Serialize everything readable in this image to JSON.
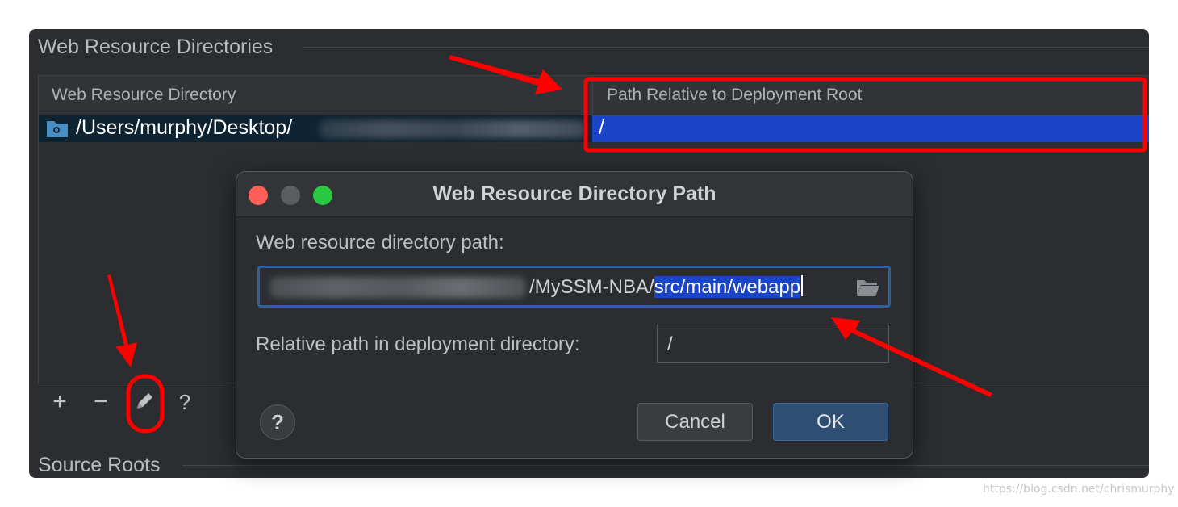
{
  "panel": {
    "section_title": "Web Resource Directories",
    "section2_title": "Source Roots",
    "table": {
      "headers": [
        "Web Resource Directory",
        "Path Relative to Deployment Root"
      ],
      "row": {
        "directory": "/Users/murphy/Desktop/",
        "relative_path": "/"
      }
    },
    "toolbar": {
      "add": "+",
      "remove": "−",
      "help": "?"
    }
  },
  "dialog": {
    "title": "Web Resource Directory Path",
    "path_label": "Web resource directory path:",
    "path_value_visible": "/MySSM-NBA/",
    "path_value_selected": "src/main/webapp",
    "relative_label": "Relative path in deployment directory:",
    "relative_value": "/",
    "help_label": "?",
    "cancel_label": "Cancel",
    "ok_label": "OK"
  },
  "watermark": "https://blog.csdn.net/chrismurphy",
  "colors": {
    "panel_bg": "#2b2d30",
    "selection_blue": "#1b45c8",
    "annotation_red": "#ff0000",
    "traffic_red": "#ff5f57",
    "traffic_gray": "#5c5d60",
    "traffic_green": "#28c840"
  },
  "icons": [
    "folder-icon",
    "browse-folder-icon",
    "edit-pencil-icon",
    "help-icon"
  ]
}
